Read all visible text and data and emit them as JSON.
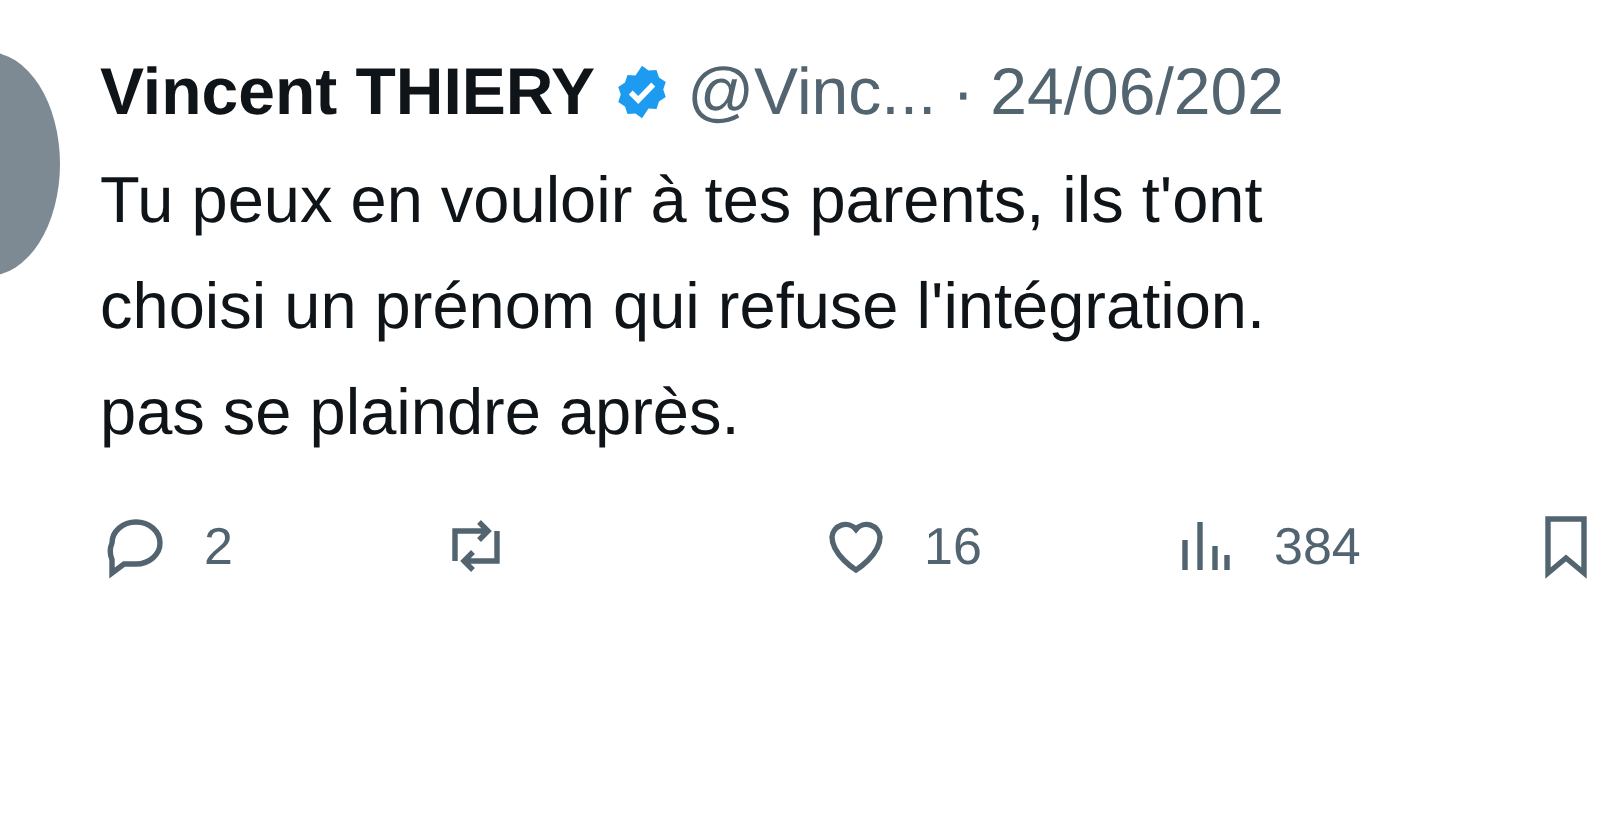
{
  "author": {
    "name": "Vincent THIERY",
    "verified": true,
    "handle": "@Vinc...",
    "separator": "·",
    "date": "24/06/202"
  },
  "lines": [
    "Tu peux en vouloir à tes parents, ils t'ont",
    "choisi un prénom qui refuse l'intégration.",
    "pas se plaindre après."
  ],
  "actions": [
    {
      "kind": "reply",
      "count": "2"
    },
    {
      "kind": "repost"
    },
    {
      "kind": "like",
      "count": "16"
    },
    {
      "kind": "views",
      "count": "384"
    },
    {
      "kind": "bookmark"
    }
  ]
}
